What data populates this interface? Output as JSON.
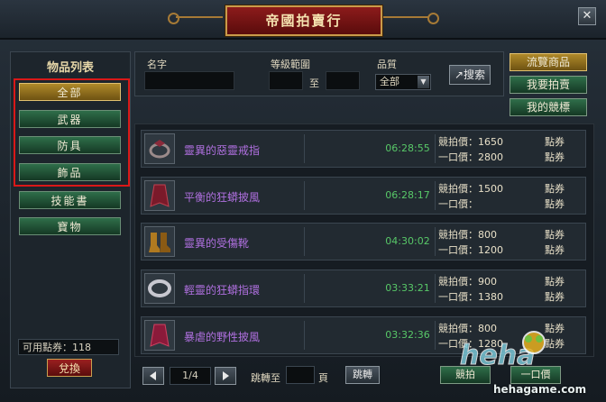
{
  "window": {
    "title": "帝國拍賣行",
    "close_label": "✕"
  },
  "sidebar": {
    "title": "物品列表",
    "categories": [
      {
        "label": "全部",
        "active": true
      },
      {
        "label": "武器",
        "active": false
      },
      {
        "label": "防具",
        "active": false
      },
      {
        "label": "飾品",
        "active": false
      },
      {
        "label": "技能書",
        "active": false
      },
      {
        "label": "寶物",
        "active": false
      }
    ],
    "points_label": "可用點券：",
    "points_value": "118",
    "exchange_label": "兌換"
  },
  "filters": {
    "name_label": "名字",
    "name_value": "",
    "level_label": "等級範圍",
    "level_to": "至",
    "level_min": "",
    "level_max": "",
    "quality_label": "品質",
    "quality_value": "全部",
    "search_label": "搜索"
  },
  "right_buttons": [
    {
      "label": "流覽商品",
      "active": true
    },
    {
      "label": "我要拍賣",
      "active": false
    },
    {
      "label": "我的競標",
      "active": false
    }
  ],
  "items": [
    {
      "name": "靈異的惡靈戒指",
      "icon": "ring-icon",
      "time": "06:28:55",
      "bid_label": "競拍價：",
      "bid": "1650",
      "buy_label": "一口價：",
      "buy": "2800",
      "cur_bid": "點券",
      "cur_buy": "點券"
    },
    {
      "name": "平衡的狂蟒披風",
      "icon": "cloak-icon",
      "time": "06:28:17",
      "bid_label": "競拍價：",
      "bid": "1500",
      "buy_label": "一口價：",
      "buy": "",
      "cur_bid": "點券",
      "cur_buy": "點券"
    },
    {
      "name": "靈異的受傷靴",
      "icon": "boots-icon",
      "time": "04:30:02",
      "bid_label": "競拍價：",
      "bid": "800",
      "buy_label": "一口價：",
      "buy": "1200",
      "cur_bid": "點券",
      "cur_buy": "點券"
    },
    {
      "name": "輕靈的狂蟒指環",
      "icon": "ring-icon",
      "time": "03:33:21",
      "bid_label": "競拍價：",
      "bid": "900",
      "buy_label": "一口價：",
      "buy": "1380",
      "cur_bid": "點券",
      "cur_buy": "點券"
    },
    {
      "name": "暴虐的野性披風",
      "icon": "cloak-icon",
      "time": "03:32:36",
      "bid_label": "競拍價：",
      "bid": "800",
      "buy_label": "一口價：",
      "buy": "1280",
      "cur_bid": "點券",
      "cur_buy": "點券"
    }
  ],
  "pager": {
    "page": "1/4",
    "jump_label": "跳轉至",
    "jump_unit": "頁",
    "jump_button": "跳轉"
  },
  "bottom_buttons": {
    "bid_label": "競拍",
    "buy_label": "一口價"
  },
  "watermark": {
    "text": "hehagame.com",
    "logo": "heha"
  },
  "colors": {
    "accent_gold": "#b08a2a",
    "button_green": "#2f6e4a",
    "title_red": "#8c1b1b",
    "item_name_purple": "#b070e0",
    "time_green": "#58c868",
    "highlight_red": "#d91818"
  }
}
